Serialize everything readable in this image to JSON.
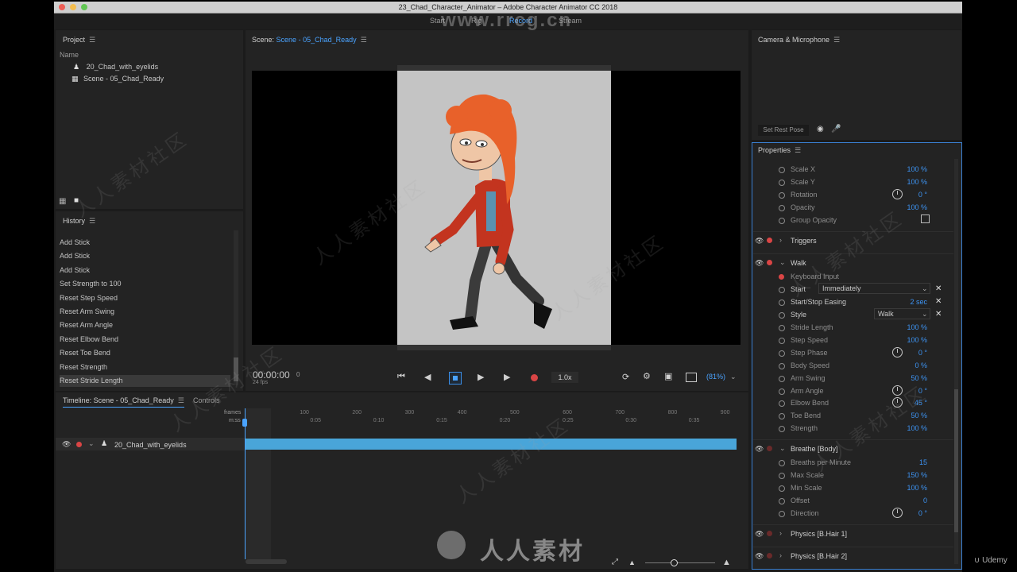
{
  "window": {
    "title": "23_Chad_Character_Animator – Adobe Character Animator CC 2018"
  },
  "workspaces": {
    "start": "Start",
    "rig": "Rig",
    "record": "Record",
    "stream": "Stream"
  },
  "watermark_top": "www.rrcg.cn",
  "watermark_bottom": "人人素材",
  "udemy": "Udemy",
  "project": {
    "title": "Project",
    "col_header": "Name",
    "items": [
      "20_Chad_with_eyelids",
      "Scene - 05_Chad_Ready"
    ]
  },
  "history": {
    "title": "History",
    "items": [
      "Add Stick",
      "Add Stick",
      "Add Stick",
      "Set Strength to 100",
      "Reset Step Speed",
      "Reset Arm Swing",
      "Reset Arm Angle",
      "Reset Elbow Bend",
      "Reset Toe Bend",
      "Reset Strength",
      "Reset Stride Length"
    ],
    "selected_index": 10
  },
  "scene": {
    "title_prefix": "Scene:",
    "title_name": "Scene - 05_Chad_Ready",
    "timecode": "00:00:00",
    "frame": "0",
    "fps": "24 fps",
    "speed": "1.0x",
    "zoom": "(81%)"
  },
  "camera": {
    "title": "Camera & Microphone",
    "rest_pose_button": "Set Rest Pose"
  },
  "timeline": {
    "title": "Timeline: Scene - 05_Chad_Ready",
    "controls_tab": "Controls",
    "frames_label": "frames",
    "mss_label": "m:ss",
    "frame_ticks": [
      "0",
      "100",
      "200",
      "300",
      "400",
      "500",
      "600",
      "700",
      "800",
      "900"
    ],
    "time_ticks": [
      "0:00",
      "0:05",
      "0:10",
      "0:15",
      "0:20",
      "0:25",
      "0:30",
      "0:35"
    ],
    "track_name": "20_Chad_with_eyelids"
  },
  "properties": {
    "title": "Properties",
    "transform_rows": [
      {
        "label": "Scale X",
        "value": "100 %"
      },
      {
        "label": "Scale Y",
        "value": "100 %"
      },
      {
        "label": "Rotation",
        "value": "0 °",
        "dial": true
      },
      {
        "label": "Opacity",
        "value": "100 %"
      },
      {
        "label": "Group Opacity",
        "value": "",
        "checkbox": true
      }
    ],
    "triggers": "Triggers",
    "walk": {
      "name": "Walk",
      "keyboard_input": "Keyboard Input",
      "start_label": "Start",
      "start_value": "Immediately",
      "easing_label": "Start/Stop Easing",
      "easing_value": "2 sec",
      "style_label": "Style",
      "style_value": "Walk",
      "rows": [
        {
          "label": "Stride Length",
          "value": "100 %"
        },
        {
          "label": "Step Speed",
          "value": "100 %"
        },
        {
          "label": "Step Phase",
          "value": "0 °",
          "dial": true
        },
        {
          "label": "Body Speed",
          "value": "0 %"
        },
        {
          "label": "Arm Swing",
          "value": "50 %"
        },
        {
          "label": "Arm Angle",
          "value": "0 °",
          "dial": true
        },
        {
          "label": "Elbow Bend",
          "value": "45 °",
          "dial": true
        },
        {
          "label": "Toe Bend",
          "value": "50 %"
        },
        {
          "label": "Strength",
          "value": "100 %"
        }
      ]
    },
    "breathe": {
      "name": "Breathe [Body]",
      "rows": [
        {
          "label": "Breaths per Minute",
          "value": "15"
        },
        {
          "label": "Max Scale",
          "value": "150 %"
        },
        {
          "label": "Min Scale",
          "value": "100 %"
        },
        {
          "label": "Offset",
          "value": "0"
        },
        {
          "label": "Direction",
          "value": "0 °",
          "dial": true
        }
      ]
    },
    "physics1": "Physics [B.Hair 1]",
    "physics2": "Physics [B.Hair 2]"
  },
  "colors": {
    "accent": "#3d93f2",
    "record": "#d94545",
    "track": "#49a5d9"
  }
}
